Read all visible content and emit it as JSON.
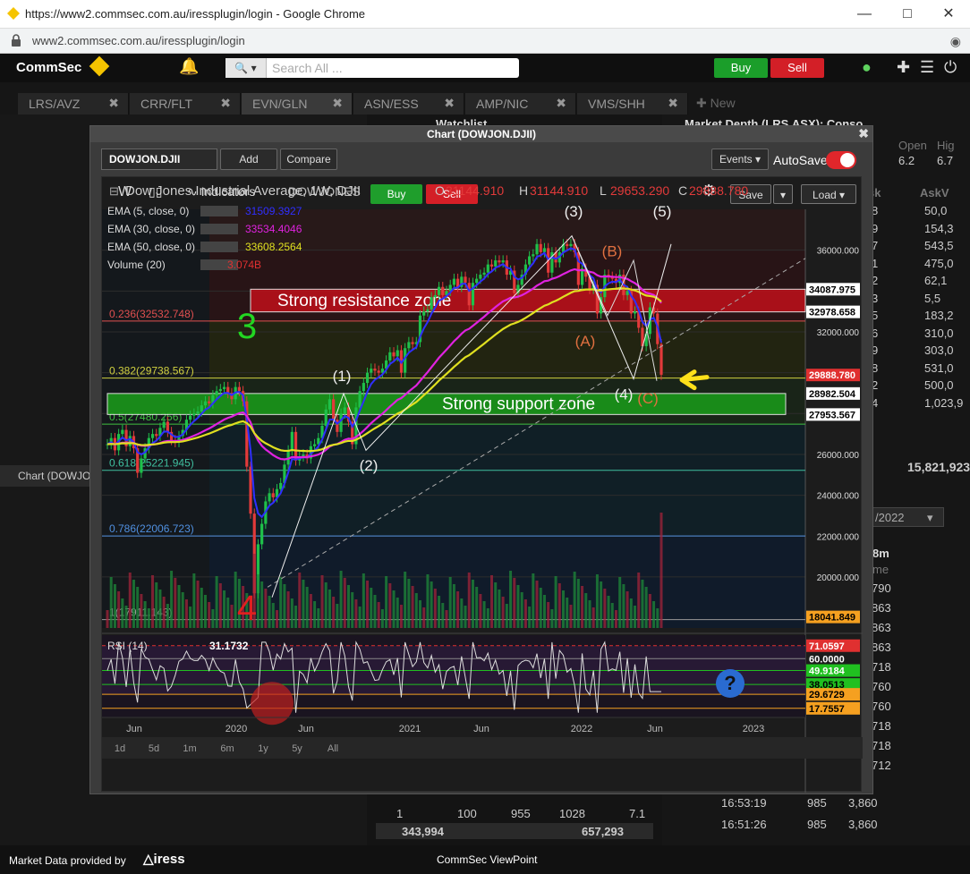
{
  "browser": {
    "title": "https://www2.commsec.com.au/iressplugin/login - Google Chrome",
    "url": "www2.commsec.com.au/iressplugin/login"
  },
  "app": {
    "logo": "CommSec",
    "search_placeholder": "Search All ...",
    "buy_label": "Buy",
    "sell_label": "Sell"
  },
  "tabs": [
    {
      "label": "LRS/AVZ"
    },
    {
      "label": "CRR/FLT"
    },
    {
      "label": "EVN/GLN"
    },
    {
      "label": "ASN/ESS"
    },
    {
      "label": "AMP/NIC"
    },
    {
      "label": "VMS/SHH"
    }
  ],
  "new_tab_label": "New",
  "background": {
    "watchlist_label": "Watchlist",
    "market_depth_label": "Market Depth (LRS.ASX): Conso...",
    "open_label": "Open",
    "high_label": "Hig",
    "open_value": "6.2",
    "high_value": "6.7",
    "bid_header": "sk",
    "ask_header": "AskV",
    "depth_bid": [
      "8",
      "9",
      "7",
      "1",
      "2",
      "3",
      "5",
      "6",
      "9",
      "8",
      "2",
      "4"
    ],
    "depth_rows": [
      "50,0",
      "154,3",
      "543,5",
      "475,0",
      "62,1",
      "5,5",
      "183,2",
      "310,0",
      "303,0",
      "531,0",
      "500,0",
      "1,023,9"
    ],
    "depth_total": "15,821,923",
    "side_chart_label": "Chart (DOWJO",
    "date_select": "/2022",
    "col_8m": "8m",
    "col_me": "me",
    "trades_prices": [
      "790",
      "863",
      "863",
      "863",
      "718",
      "760",
      "760",
      "718",
      "718",
      "712"
    ],
    "trade_rows": [
      {
        "time": "16:53:19",
        "vol": "985",
        "val": "3,860"
      },
      {
        "time": "16:51:26",
        "vol": "985",
        "val": "3,860"
      }
    ],
    "summary_row": [
      "1",
      "100",
      "955",
      "1028",
      "7.1"
    ],
    "summary_totals": [
      "343,994",
      "657,293"
    ]
  },
  "chart_window": {
    "title": "Chart (DOWJON.DJII)",
    "symbol": "DOWJON.DJII",
    "add_label": "Add",
    "compare_label": "Compare",
    "events_label": "Events",
    "autosave_label": "AutoSave",
    "interval_label": "W",
    "indicators_label": "Indicators",
    "symbol_short": "DOWJONES",
    "buy_label": "Buy",
    "sell_label": "Sell",
    "save_label": "Save",
    "load_label": "Load"
  },
  "chart_data": {
    "type": "candlestick",
    "title": "Dow Jones Industrial Average, 1W, DJII",
    "ohlc": {
      "O": "31144.910",
      "H": "31144.910",
      "L": "29653.290",
      "C": "29888.780"
    },
    "indicators": [
      {
        "name": "EMA (5, close, 0)",
        "value": "31509.3927",
        "color": "#2f2fff"
      },
      {
        "name": "EMA (30, close, 0)",
        "value": "33534.4046",
        "color": "#e022e0"
      },
      {
        "name": "EMA (50, close, 0)",
        "value": "33608.2564",
        "color": "#e0e020"
      },
      {
        "name": "Volume (20)",
        "value": "3.074B",
        "color": "#e03030"
      }
    ],
    "y_ticks": [
      20000,
      22000,
      24000,
      26000,
      28000,
      30000,
      32000,
      34000,
      36000
    ],
    "y_tick_labels": [
      "20000.000",
      "22000.000",
      "24000.000",
      "26000.000",
      "28000.000",
      "30000.000",
      "32000.000",
      "34000.000",
      "36000.000"
    ],
    "x_ticks": [
      "Jun",
      "2020",
      "Jun",
      "2021",
      "Jun",
      "2022",
      "Jun",
      "2023"
    ],
    "ylim": [
      17500,
      38000
    ],
    "fib_levels": [
      {
        "label": "0.236(32532.748)",
        "value": 32532.748,
        "color": "#e05050"
      },
      {
        "label": "0.382(29738.567)",
        "value": 29738.567,
        "color": "#d0d040"
      },
      {
        "label": "0.5(27480.256)",
        "value": 27480.256,
        "color": "#40c040"
      },
      {
        "label": "0.618(25221.945)",
        "value": 25221.945,
        "color": "#40c0a0"
      },
      {
        "label": "0.786(22006.723)",
        "value": 22006.723,
        "color": "#5090e0"
      },
      {
        "label": "1(17911.143)",
        "value": 17911.143,
        "color": "#999999"
      }
    ],
    "price_labels": [
      {
        "text": "34087.975",
        "value": 34087.975,
        "bg": "#ffffff",
        "fg": "#000000"
      },
      {
        "text": "32978.658",
        "value": 32978.658,
        "bg": "#ffffff",
        "fg": "#000000"
      },
      {
        "text": "29888.780",
        "value": 29888.78,
        "bg": "#e03030",
        "fg": "#ffffff"
      },
      {
        "text": "28982.504",
        "value": 28982.504,
        "bg": "#ffffff",
        "fg": "#000000"
      },
      {
        "text": "27953.567",
        "value": 27953.567,
        "bg": "#ffffff",
        "fg": "#000000"
      },
      {
        "text": "18041.849",
        "value": 18041.849,
        "bg": "#f5a020",
        "fg": "#000000"
      }
    ],
    "zones": [
      {
        "label": "Strong resistance zone",
        "from": 32978.658,
        "to": 34087.975,
        "color": "#c0101a"
      },
      {
        "label": "Strong support zone",
        "from": 27953.567,
        "to": 28982.504,
        "color": "#1a9e1a"
      }
    ],
    "annotations": [
      "3",
      "4",
      "(1)",
      "(2)",
      "(3)",
      "(4)",
      "(5)",
      "(A)",
      "(B)",
      "(C)"
    ],
    "close_series": [
      26500,
      26800,
      26200,
      27000,
      27200,
      26400,
      26900,
      26300,
      25100,
      25800,
      26300,
      26800,
      27000,
      26900,
      27300,
      27600,
      27100,
      26700,
      26600,
      26900,
      27200,
      27700,
      27900,
      28000,
      28100,
      28400,
      28600,
      28500,
      28900,
      29100,
      29200,
      29300,
      29000,
      28700,
      29300,
      29100,
      28600,
      25400,
      23100,
      19200,
      21600,
      22600,
      23700,
      24100,
      23900,
      24300,
      24600,
      25500,
      26200,
      27100,
      25700,
      25900,
      26000,
      25800,
      26400,
      26500,
      26800,
      27400,
      28200,
      28700,
      27700,
      27100,
      28000,
      28300,
      27600,
      26500,
      28300,
      29100,
      29500,
      30000,
      30200,
      30100,
      30000,
      30200,
      30600,
      31000,
      30800,
      31100,
      30000,
      31200,
      31500,
      31400,
      31500,
      32800,
      33000,
      33100,
      33700,
      33800,
      34200,
      33800,
      34000,
      34300,
      34600,
      34200,
      34700,
      34400,
      33300,
      34400,
      34600,
      34800,
      34900,
      35300,
      35200,
      35500,
      35400,
      35500,
      34800,
      35000,
      33900,
      34300,
      34800,
      35300,
      35700,
      35800,
      36300,
      35900,
      36100,
      34900,
      35900,
      35400,
      35900,
      36300,
      36200,
      36300,
      35900,
      34300,
      35100,
      34700,
      34100,
      34300,
      32900,
      33700,
      34800,
      34700,
      34600,
      34400,
      34800,
      33800,
      34000,
      32900,
      33000,
      32200,
      31300,
      31900,
      33200,
      32900,
      31400,
      29900
    ],
    "rsi": {
      "label": "RSI (14)",
      "value": "31.1732",
      "levels": [
        {
          "text": "71.0597",
          "value": 71.0597,
          "bg": "#e03030",
          "fg": "#ffffff"
        },
        {
          "text": "60.0000",
          "value": 60,
          "bg": "#1c1c1c",
          "fg": "#ffffff"
        },
        {
          "text": "49.9184",
          "value": 49.9184,
          "bg": "#20c020",
          "fg": "#ffffff"
        },
        {
          "text": "38.0513",
          "value": 38.0513,
          "bg": "#20c020",
          "fg": "#000000"
        },
        {
          "text": "29.6729",
          "value": 29.6729,
          "bg": "#f5a020",
          "fg": "#000000"
        },
        {
          "text": "17.7557",
          "value": 17.7557,
          "bg": "#f5a020",
          "fg": "#000000"
        }
      ]
    },
    "ranges": [
      "1d",
      "5d",
      "1m",
      "6m",
      "1y",
      "5y",
      "All"
    ]
  },
  "footer": {
    "provider_text": "Market Data provided by",
    "provider_logo": "iress",
    "app_name": "CommSec ViewPoint"
  }
}
